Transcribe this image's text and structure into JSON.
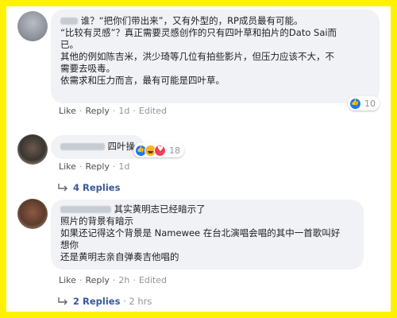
{
  "colors": {
    "frame": "#fff200",
    "bubble": "#f0f2f5",
    "link": "#385898",
    "muted": "#90949c"
  },
  "comments": [
    {
      "lines": [
        "谁？“把你们带出来”，又有外型的，RP成员最有可能。",
        "“比较有灵感”？真正需要灵感创作的只有四叶草和拍片的Dato Sai而",
        "已。",
        "其他的例如陈吉米，洪少琦等几位有拍些影片，但压力应该不大，不",
        "需要去吸毒。",
        "依需求和压力而言，最有可能是四叶草。"
      ],
      "reaction_count": "10",
      "actions": {
        "like": "Like",
        "reply": "Reply",
        "time": "1d",
        "edited": "Edited"
      }
    },
    {
      "lines": [
        "四叶操"
      ],
      "reaction_count": "18",
      "actions": {
        "like": "Like",
        "reply": "Reply",
        "time": "1d"
      },
      "replies": {
        "label": "4 Replies"
      }
    },
    {
      "lines": [
        "其实黄明志已经暗示了",
        "照片的背景有暗示",
        "如果还记得这个背景是 Namewee 在台北演唱会唱的其中一首歌叫好",
        "想你",
        "还是黄明志亲自弹奏吉他唱的"
      ],
      "actions": {
        "like": "Like",
        "reply": "Reply",
        "time": "2h",
        "edited": "Edited"
      },
      "replies": {
        "label": "2 Replies",
        "time": "2 hrs"
      }
    }
  ]
}
